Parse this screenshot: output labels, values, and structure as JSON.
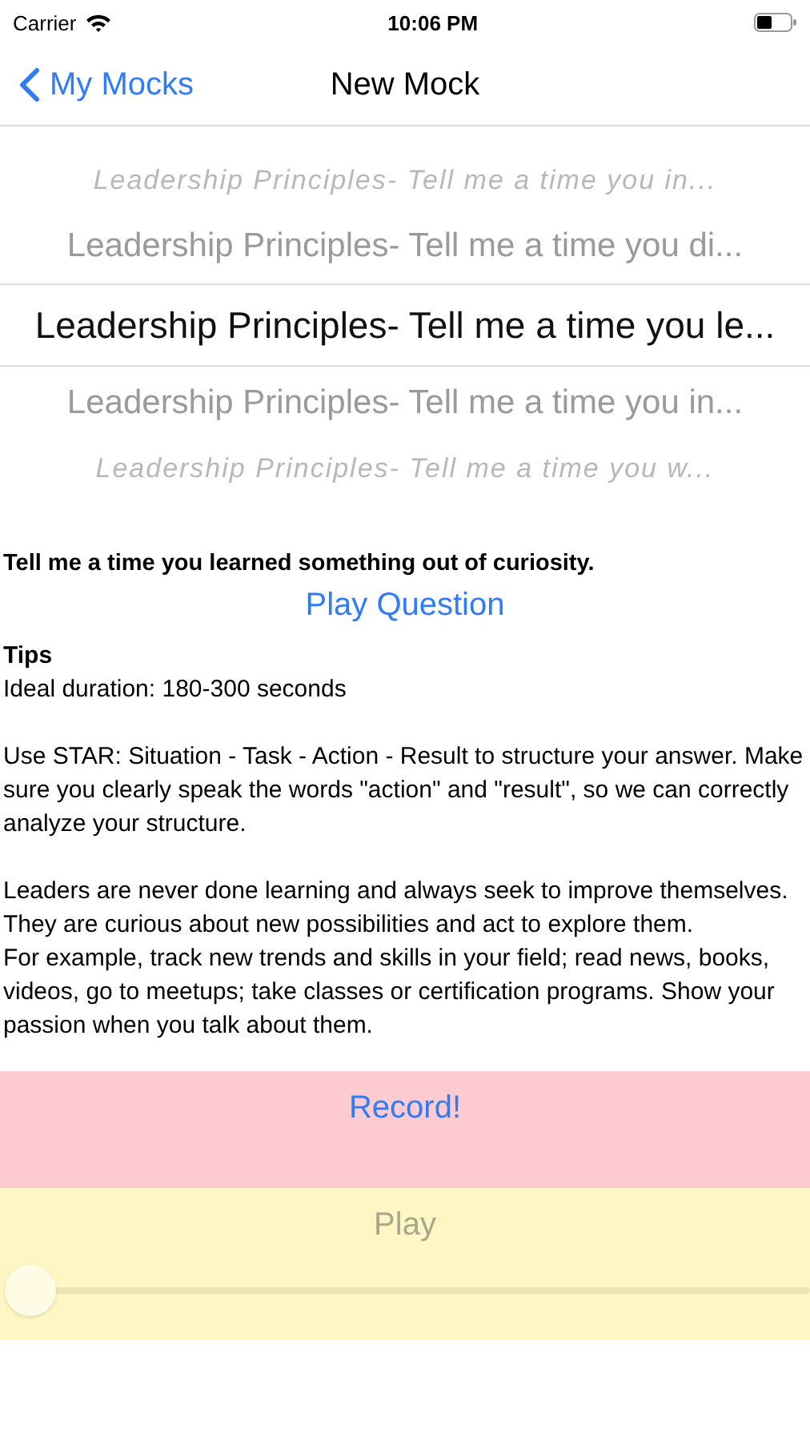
{
  "status_bar": {
    "carrier": "Carrier",
    "time": "10:06 PM"
  },
  "nav": {
    "back": "My Mocks",
    "title": "New Mock"
  },
  "picker": [
    {
      "label": "Leadership Principles- Tell me a time you in...",
      "selected": false
    },
    {
      "label": "Leadership Principles- Tell me a time you di...",
      "selected": false
    },
    {
      "label": "Leadership Principles- Tell me a time you le...",
      "selected": true
    },
    {
      "label": "Leadership Principles- Tell me a time you in...",
      "selected": false
    },
    {
      "label": "Leadership Principles- Tell me a time you w...",
      "selected": false
    }
  ],
  "question": "Tell me a time you learned something out of curiosity.",
  "play_question": "Play Question",
  "tips": {
    "heading": "Tips",
    "blocks": [
      [
        "Ideal duration: 180-300 seconds"
      ],
      [
        "Use STAR: Situation - Task - Action - Result to structure your answer. Make sure you clearly speak the words \"action\" and \"result\", so we can correctly analyze your structure."
      ],
      [
        "Leaders are never done learning and always seek to improve themselves. They are curious about new possibilities and act to explore them.",
        " For example, track new trends and skills in your field; read news, books, videos, go to meetups; take classes or certification programs. Show your passion when you talk about them."
      ]
    ]
  },
  "record": {
    "label": "Record!"
  },
  "playback": {
    "label": "Play",
    "disabled": true,
    "level": 0
  }
}
